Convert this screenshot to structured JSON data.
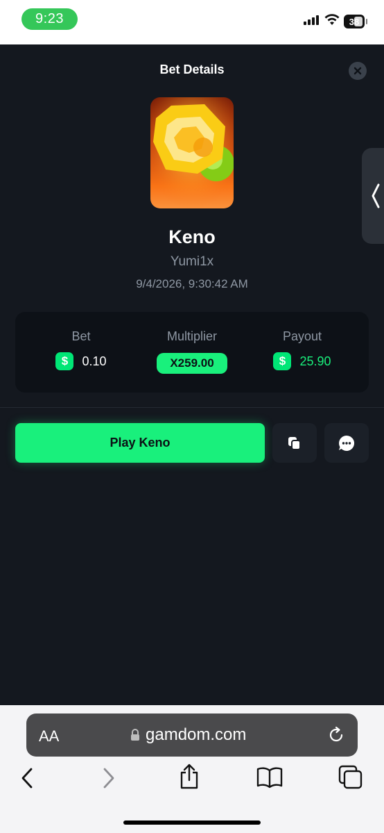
{
  "status_bar": {
    "time": "9:23",
    "battery": "38"
  },
  "modal": {
    "title": "Bet Details"
  },
  "game": {
    "name": "Keno",
    "user": "Yumi1x",
    "datetime": "9/4/2026, 9:30:42 AM"
  },
  "stats": {
    "bet_label": "Bet",
    "bet_currency": "$",
    "bet_value": "0.10",
    "multiplier_label": "Multiplier",
    "multiplier_value": "X259.00",
    "payout_label": "Payout",
    "payout_currency": "$",
    "payout_value": "25.90"
  },
  "actions": {
    "play_label": "Play Keno"
  },
  "browser": {
    "aa_label": "AA",
    "url": "gamdom.com"
  },
  "colors": {
    "accent": "#19f07c",
    "background": "#14181f",
    "card": "#0d1117"
  }
}
